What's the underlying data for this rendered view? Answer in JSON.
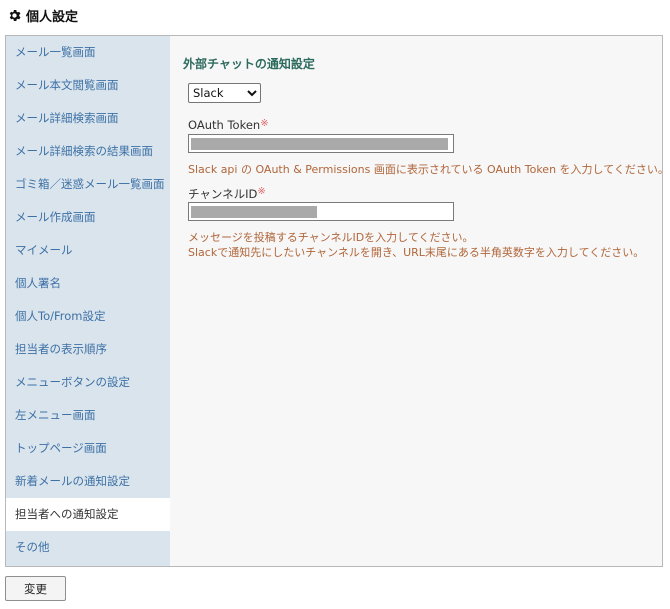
{
  "header": {
    "title": "個人設定",
    "icon": "gear-icon"
  },
  "sidebar": {
    "items": [
      {
        "label": "メール一覧画面"
      },
      {
        "label": "メール本文閲覧画面"
      },
      {
        "label": "メール詳細検索画面"
      },
      {
        "label": "メール詳細検索の結果画面"
      },
      {
        "label": "ゴミ箱／迷惑メール一覧画面"
      },
      {
        "label": "メール作成画面"
      },
      {
        "label": "マイメール"
      },
      {
        "label": "個人署名"
      },
      {
        "label": "個人To/From設定"
      },
      {
        "label": "担当者の表示順序"
      },
      {
        "label": "メニューボタンの設定"
      },
      {
        "label": "左メニュー画面"
      },
      {
        "label": "トップページ画面"
      },
      {
        "label": "新着メールの通知設定"
      },
      {
        "label": "担当者への通知設定",
        "active": true
      },
      {
        "label": "その他"
      }
    ]
  },
  "main": {
    "title": "外部チャットの通知設定",
    "service_select": {
      "value": "Slack",
      "options": [
        "Slack"
      ]
    },
    "token": {
      "label": "OAuth Token",
      "required_mark": "※",
      "help": "Slack api の OAuth & Permissions 画面に表示されている OAuth Token を入力してください。"
    },
    "channel": {
      "label": "チャンネルID",
      "required_mark": "※",
      "help_line1": "メッセージを投稿するチャンネルIDを入力してください。",
      "help_line2": "Slackで通知先にしたいチャンネルを開き、URL末尾にある半角英数字を入力してください。"
    }
  },
  "footer": {
    "submit_label": "変更"
  },
  "colors": {
    "sidebar_bg": "#dae4ec",
    "sidebar_link": "#3d71a6",
    "title_green": "#2d6b5e",
    "help_orange": "#b0663a",
    "required_red": "#e06b6b"
  }
}
